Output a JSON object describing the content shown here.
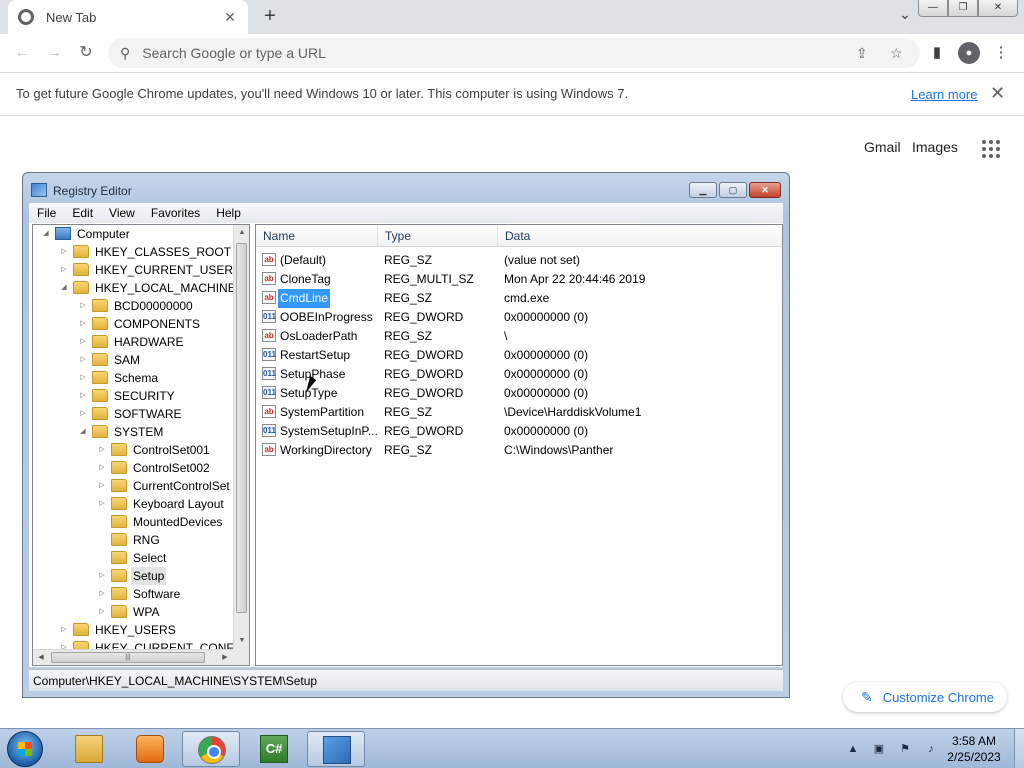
{
  "browser": {
    "tab_title": "New Tab",
    "tab_close": "✕",
    "new_tab": "+",
    "tab_search": "⌄",
    "window_controls": {
      "minimize": "—",
      "maximize": "❐",
      "close": "✕"
    },
    "nav": {
      "back": "←",
      "forward": "→",
      "reload": "↻"
    },
    "omnibox_placeholder": "Search Google or type a URL",
    "omnibox_icon": "search-icon",
    "toolbar_icons": {
      "share": "⇪",
      "bookmark": "☆",
      "side_panel": "▮",
      "profile": "●",
      "menu": "⋮"
    },
    "infobar": {
      "text": "To get future Google Chrome updates, you'll need Windows 10 or later. This computer is using Windows 7.",
      "link": "Learn more",
      "close": "✕"
    },
    "ntp": {
      "gmail": "Gmail",
      "images": "Images",
      "customize": "Customize Chrome",
      "customize_icon": "✎"
    }
  },
  "regedit": {
    "title": "Registry Editor",
    "controls": {
      "minimize": "▁",
      "maximize": "▢",
      "close": "✕"
    },
    "menu": [
      "File",
      "Edit",
      "View",
      "Favorites",
      "Help"
    ],
    "tree": {
      "root": "Computer",
      "nodes": [
        {
          "label": "HKEY_CLASSES_ROOT",
          "arrow": "▷"
        },
        {
          "label": "HKEY_CURRENT_USER",
          "arrow": "▷"
        },
        {
          "label": "HKEY_LOCAL_MACHINE",
          "arrow": "◢"
        },
        {
          "label": "BCD00000000",
          "arrow": "▷"
        },
        {
          "label": "COMPONENTS",
          "arrow": "▷"
        },
        {
          "label": "HARDWARE",
          "arrow": "▷"
        },
        {
          "label": "SAM",
          "arrow": "▷"
        },
        {
          "label": "Schema",
          "arrow": "▷"
        },
        {
          "label": "SECURITY",
          "arrow": "▷"
        },
        {
          "label": "SOFTWARE",
          "arrow": "▷"
        },
        {
          "label": "SYSTEM",
          "arrow": "◢"
        },
        {
          "label": "ControlSet001",
          "arrow": "▷"
        },
        {
          "label": "ControlSet002",
          "arrow": "▷"
        },
        {
          "label": "CurrentControlSet",
          "arrow": "▷"
        },
        {
          "label": "Keyboard Layout",
          "arrow": "▷"
        },
        {
          "label": "MountedDevices",
          "arrow": ""
        },
        {
          "label": "RNG",
          "arrow": ""
        },
        {
          "label": "Select",
          "arrow": ""
        },
        {
          "label": "Setup",
          "arrow": "▷"
        },
        {
          "label": "Software",
          "arrow": "▷"
        },
        {
          "label": "WPA",
          "arrow": "▷"
        },
        {
          "label": "HKEY_USERS",
          "arrow": "▷"
        },
        {
          "label": "HKEY_CURRENT_CONFIG",
          "arrow": "▷"
        }
      ],
      "scroll": {
        "up": "▲",
        "down": "▼",
        "left": "◀",
        "right": "▶",
        "grip": "|||"
      }
    },
    "columns": {
      "name": "Name",
      "type": "Type",
      "data": "Data"
    },
    "values": [
      {
        "icon": "ab",
        "name": "(Default)",
        "type": "REG_SZ",
        "data": "(value not set)"
      },
      {
        "icon": "ab",
        "name": "CloneTag",
        "type": "REG_MULTI_SZ",
        "data": "Mon Apr 22 20:44:46 2019"
      },
      {
        "icon": "ab",
        "name": "CmdLine",
        "type": "REG_SZ",
        "data": "cmd.exe"
      },
      {
        "icon": "011",
        "name": "OOBEInProgress",
        "type": "REG_DWORD",
        "data": "0x00000000 (0)"
      },
      {
        "icon": "ab",
        "name": "OsLoaderPath",
        "type": "REG_SZ",
        "data": "\\"
      },
      {
        "icon": "011",
        "name": "RestartSetup",
        "type": "REG_DWORD",
        "data": "0x00000000 (0)"
      },
      {
        "icon": "011",
        "name": "SetupPhase",
        "type": "REG_DWORD",
        "data": "0x00000000 (0)"
      },
      {
        "icon": "011",
        "name": "SetupType",
        "type": "REG_DWORD",
        "data": "0x00000000 (0)"
      },
      {
        "icon": "ab",
        "name": "SystemPartition",
        "type": "REG_SZ",
        "data": "\\Device\\HarddiskVolume1"
      },
      {
        "icon": "011",
        "name": "SystemSetupInP...",
        "type": "REG_DWORD",
        "data": "0x00000000 (0)"
      },
      {
        "icon": "ab",
        "name": "WorkingDirectory",
        "type": "REG_SZ",
        "data": "C:\\Windows\\Panther"
      }
    ],
    "status": "Computer\\HKEY_LOCAL_MACHINE\\SYSTEM\\Setup"
  },
  "taskbar": {
    "csharp_glyph": "C#",
    "tray": {
      "overflow": "▲",
      "network": "▣",
      "flag": "⚑",
      "volume": "♪"
    },
    "time": "3:58 AM",
    "date": "2/25/2023"
  }
}
